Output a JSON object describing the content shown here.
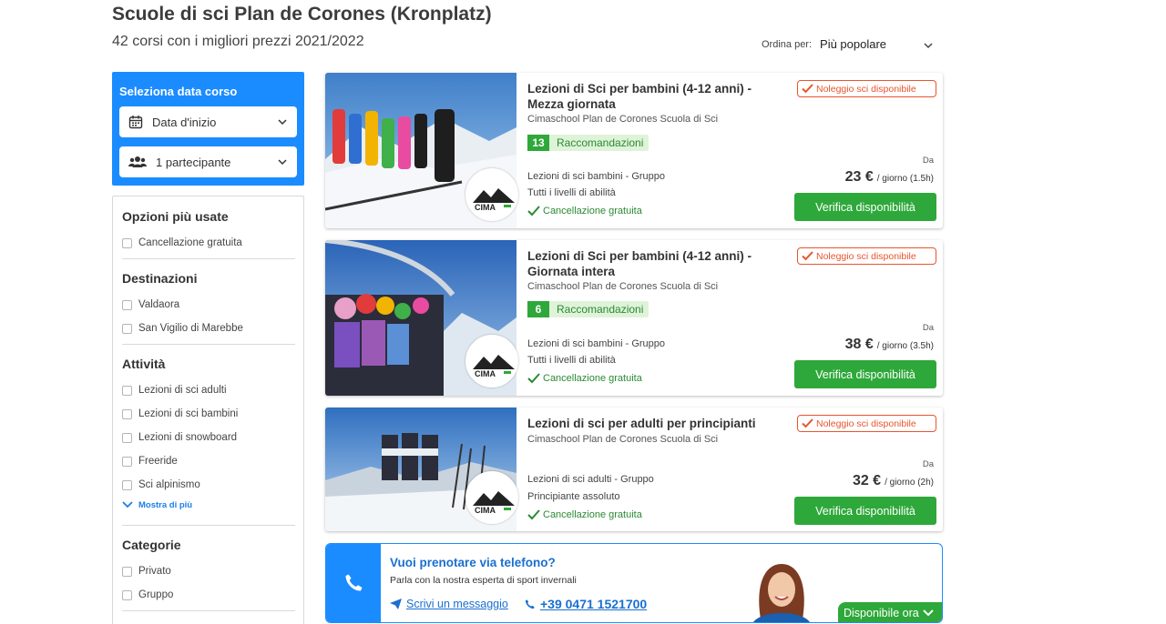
{
  "header": {
    "title": "Scuole di sci Plan de Corones (Kronplatz)",
    "subtitle": "42 corsi con i migliori prezzi 2021/2022",
    "sort_label": "Ordina per:",
    "sort_value": "Più popolare"
  },
  "date_box": {
    "title": "Seleziona data corso",
    "date_placeholder": "Data d'inizio",
    "participants": "1 partecipante"
  },
  "filters": {
    "popular": {
      "title": "Opzioni più usate",
      "items": [
        "Cancellazione gratuita"
      ]
    },
    "destinations": {
      "title": "Destinazioni",
      "items": [
        "Valdaora",
        "San Vigilio di Marebbe"
      ]
    },
    "activities": {
      "title": "Attività",
      "items": [
        "Lezioni di sci adulti",
        "Lezioni di sci bambini",
        "Lezioni di snowboard",
        "Freeride",
        "Sci alpinismo"
      ],
      "show_more": "Mostra di più"
    },
    "categories": {
      "title": "Categorie",
      "items": [
        "Privato",
        "Gruppo"
      ]
    }
  },
  "cards": [
    {
      "title": "Lezioni di Sci per bambini (4-12 anni) - Mezza giornata",
      "provider": "Cimaschool Plan de Corones Scuola di Sci",
      "rec_count": "13",
      "rec_label": "Raccomandazioni",
      "type": "Lezioni di sci bambini - Gruppo",
      "level": "Tutti i livelli di abilità",
      "cancel": "Cancellazione gratuita",
      "rental": "Noleggio sci disponibile",
      "price_from": "Da",
      "price": "23 €",
      "price_unit": "/ giorno (1.5h)",
      "button": "Verifica disponibilità"
    },
    {
      "title": "Lezioni di Sci per bambini (4-12 anni) - Giornata intera",
      "provider": "Cimaschool Plan de Corones Scuola di Sci",
      "rec_count": "6",
      "rec_label": "Raccomandazioni",
      "type": "Lezioni di sci bambini - Gruppo",
      "level": "Tutti i livelli di abilità",
      "cancel": "Cancellazione gratuita",
      "rental": "Noleggio sci disponibile",
      "price_from": "Da",
      "price": "38 €",
      "price_unit": "/ giorno (3.5h)",
      "button": "Verifica disponibilità"
    },
    {
      "title": "Lezioni di sci per adulti per principianti",
      "provider": "Cimaschool Plan de Corones Scuola di Sci",
      "type": "Lezioni di sci adulti - Gruppo",
      "level": "Principiante assoluto",
      "cancel": "Cancellazione gratuita",
      "rental": "Noleggio sci disponibile",
      "price_from": "Da",
      "price": "32 €",
      "price_unit": "/ giorno (2h)",
      "button": "Verifica disponibilità"
    }
  ],
  "phone_banner": {
    "title": "Vuoi prenotare via telefono?",
    "subtitle": "Parla con la nostra esperta di sport invernali",
    "message_link": "Scrivi un messaggio",
    "phone_number": "+39 0471 1521700",
    "available": "Disponibile ora"
  },
  "colors": {
    "primary_blue": "#1a8cff",
    "green": "#2ea83a",
    "orange": "#e8552e"
  },
  "icons": [
    "calendar-icon",
    "people-icon",
    "chevron-down-icon",
    "check-icon",
    "phone-icon",
    "send-icon"
  ]
}
